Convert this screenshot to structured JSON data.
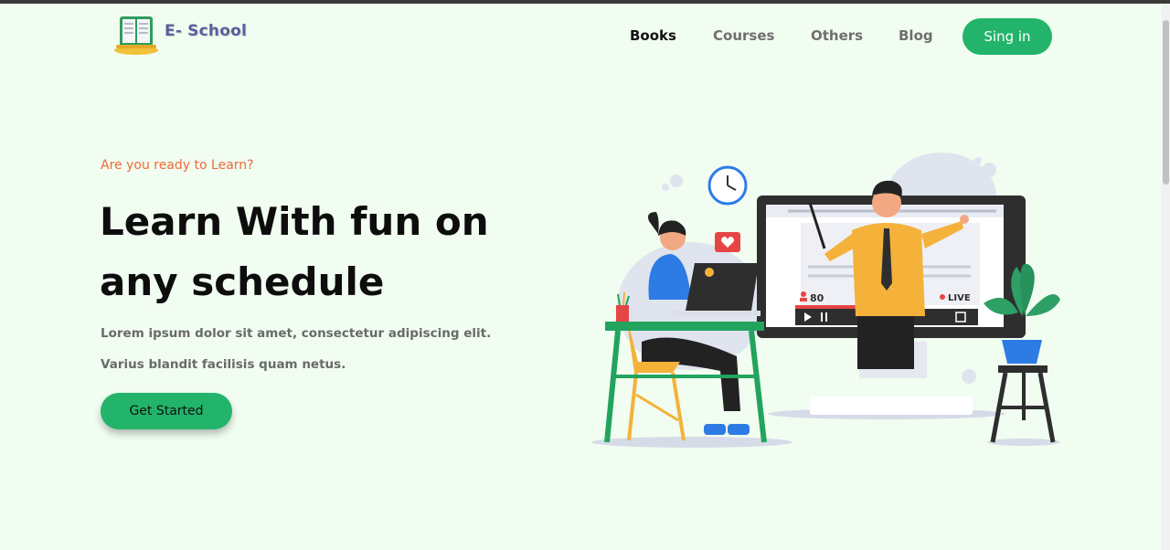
{
  "brand": {
    "name": "E- School",
    "icon": "book-logo-icon"
  },
  "nav": {
    "items": [
      {
        "label": "Books",
        "active": true
      },
      {
        "label": "Courses",
        "active": false
      },
      {
        "label": "Others",
        "active": false
      },
      {
        "label": "Blog",
        "active": false
      }
    ],
    "signin_label": "Sing in"
  },
  "hero": {
    "tagline": "Are you ready to Learn?",
    "title": "Learn With fun on any schedule",
    "description": "Lorem ipsum dolor sit amet, consectetur adipiscing elit. Varius blandit facilisis quam netus.",
    "cta_label": "Get Started"
  },
  "illustration": {
    "viewer_count": "80",
    "live_label": "LIVE",
    "icons": [
      "clock-icon",
      "heart-icon",
      "play-icon",
      "pause-icon",
      "fullscreen-icon",
      "user-icon",
      "plant-icon"
    ]
  },
  "colors": {
    "background": "#f0fdf0",
    "accent": "#22b46a",
    "tagline": "#f06a3a",
    "brand_text": "#5b5f9e"
  }
}
